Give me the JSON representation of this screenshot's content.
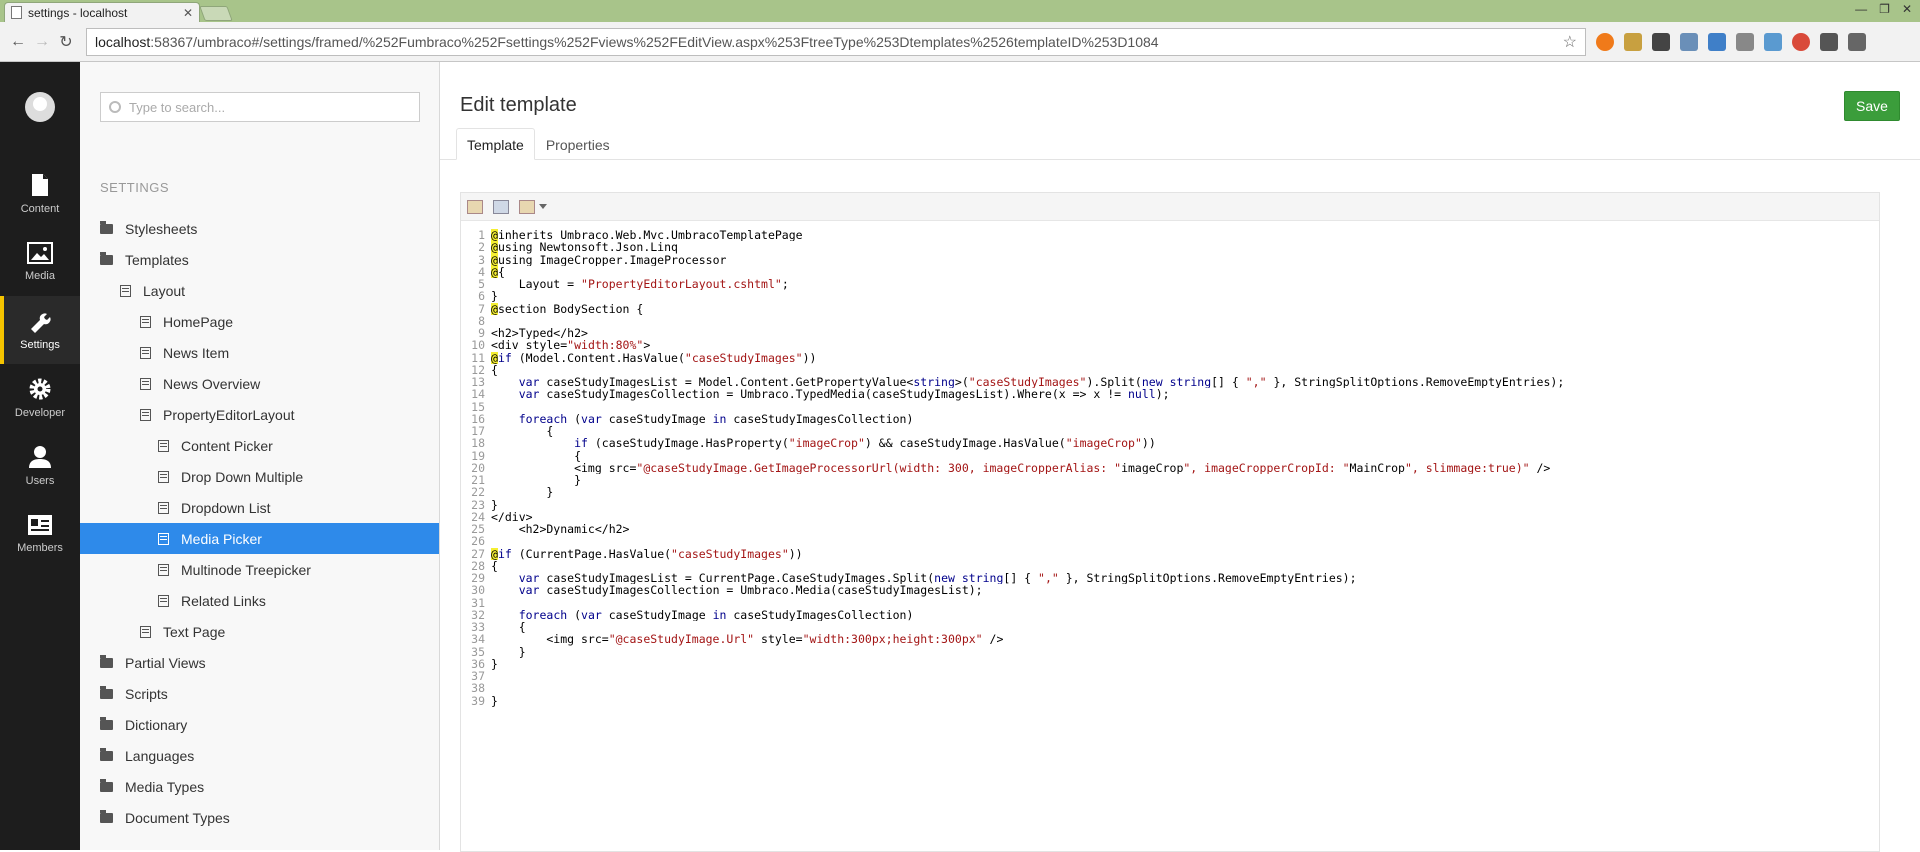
{
  "browser": {
    "tab_title": "settings - localhost",
    "url_host": "localhost",
    "url_rest": ":58367/umbraco#/settings/framed/%252Fumbraco%252Fsettings%252Fviews%252FEditView.aspx%253FtreeType%253Dtemplates%2526templateID%253D1084"
  },
  "search": {
    "placeholder": "Type to search..."
  },
  "sections": [
    {
      "label": "Content",
      "icon": "document-icon"
    },
    {
      "label": "Media",
      "icon": "image-icon"
    },
    {
      "label": "Settings",
      "icon": "wrench-icon"
    },
    {
      "label": "Developer",
      "icon": "gear-icon"
    },
    {
      "label": "Users",
      "icon": "user-icon"
    },
    {
      "label": "Members",
      "icon": "id-card-icon"
    }
  ],
  "tree": {
    "title": "SETTINGS",
    "items": [
      {
        "label": "Stylesheets",
        "type": "folder",
        "level": 0
      },
      {
        "label": "Templates",
        "type": "folder",
        "level": 0
      },
      {
        "label": "Layout",
        "type": "template",
        "level": 1
      },
      {
        "label": "HomePage",
        "type": "template",
        "level": 2
      },
      {
        "label": "News Item",
        "type": "template",
        "level": 2
      },
      {
        "label": "News Overview",
        "type": "template",
        "level": 2
      },
      {
        "label": "PropertyEditorLayout",
        "type": "template",
        "level": 2
      },
      {
        "label": "Content Picker",
        "type": "template",
        "level": 3
      },
      {
        "label": "Drop Down Multiple",
        "type": "template",
        "level": 3
      },
      {
        "label": "Dropdown List",
        "type": "template",
        "level": 3
      },
      {
        "label": "Media Picker",
        "type": "template",
        "level": 3,
        "selected": true
      },
      {
        "label": "Multinode Treepicker",
        "type": "template",
        "level": 3
      },
      {
        "label": "Related Links",
        "type": "template",
        "level": 3
      },
      {
        "label": "Text Page",
        "type": "template",
        "level": 2
      },
      {
        "label": "Partial Views",
        "type": "folder",
        "level": 0
      },
      {
        "label": "Scripts",
        "type": "folder",
        "level": 0
      },
      {
        "label": "Dictionary",
        "type": "folder",
        "level": 0
      },
      {
        "label": "Languages",
        "type": "folder",
        "level": 0
      },
      {
        "label": "Media Types",
        "type": "folder",
        "level": 0
      },
      {
        "label": "Document Types",
        "type": "folder",
        "level": 0
      }
    ]
  },
  "editor": {
    "title": "Edit template",
    "save_label": "Save",
    "tabs": [
      "Template",
      "Properties"
    ]
  },
  "code_lines": [
    "@inherits Umbraco.Web.Mvc.UmbracoTemplatePage",
    "@using Newtonsoft.Json.Linq",
    "@using ImageCropper.ImageProcessor",
    "@{",
    "    Layout = \"PropertyEditorLayout.cshtml\";",
    "}",
    "@section BodySection {",
    "",
    "<h2>Typed</h2>",
    "<div style=\"width:80%\">",
    "@if (Model.Content.HasValue(\"caseStudyImages\"))",
    "{",
    "    var caseStudyImagesList = Model.Content.GetPropertyValue<string>(\"caseStudyImages\").Split(new string[] { \",\" }, StringSplitOptions.RemoveEmptyEntries);",
    "    var caseStudyImagesCollection = Umbraco.TypedMedia(caseStudyImagesList).Where(x => x != null);",
    "",
    "    foreach (var caseStudyImage in caseStudyImagesCollection)",
    "        {",
    "            if (caseStudyImage.HasProperty(\"imageCrop\") && caseStudyImage.HasValue(\"imageCrop\"))",
    "            {",
    "            <img src=\"@caseStudyImage.GetImageProcessorUrl(width: 300, imageCropperAlias: \"imageCrop\", imageCropperCropId: \"MainCrop\", slimmage:true)\" />",
    "            }",
    "        }",
    "}",
    "</div>",
    "    <h2>Dynamic</h2>",
    "",
    "@if (CurrentPage.HasValue(\"caseStudyImages\"))",
    "{",
    "    var caseStudyImagesList = CurrentPage.CaseStudyImages.Split(new string[] { \",\" }, StringSplitOptions.RemoveEmptyEntries);",
    "    var caseStudyImagesCollection = Umbraco.Media(caseStudyImagesList);",
    "",
    "    foreach (var caseStudyImage in caseStudyImagesCollection)",
    "    {",
    "        <img src=\"@caseStudyImage.Url\" style=\"width:300px;height:300px\" />",
    "    }",
    "}",
    "",
    "",
    "}"
  ]
}
